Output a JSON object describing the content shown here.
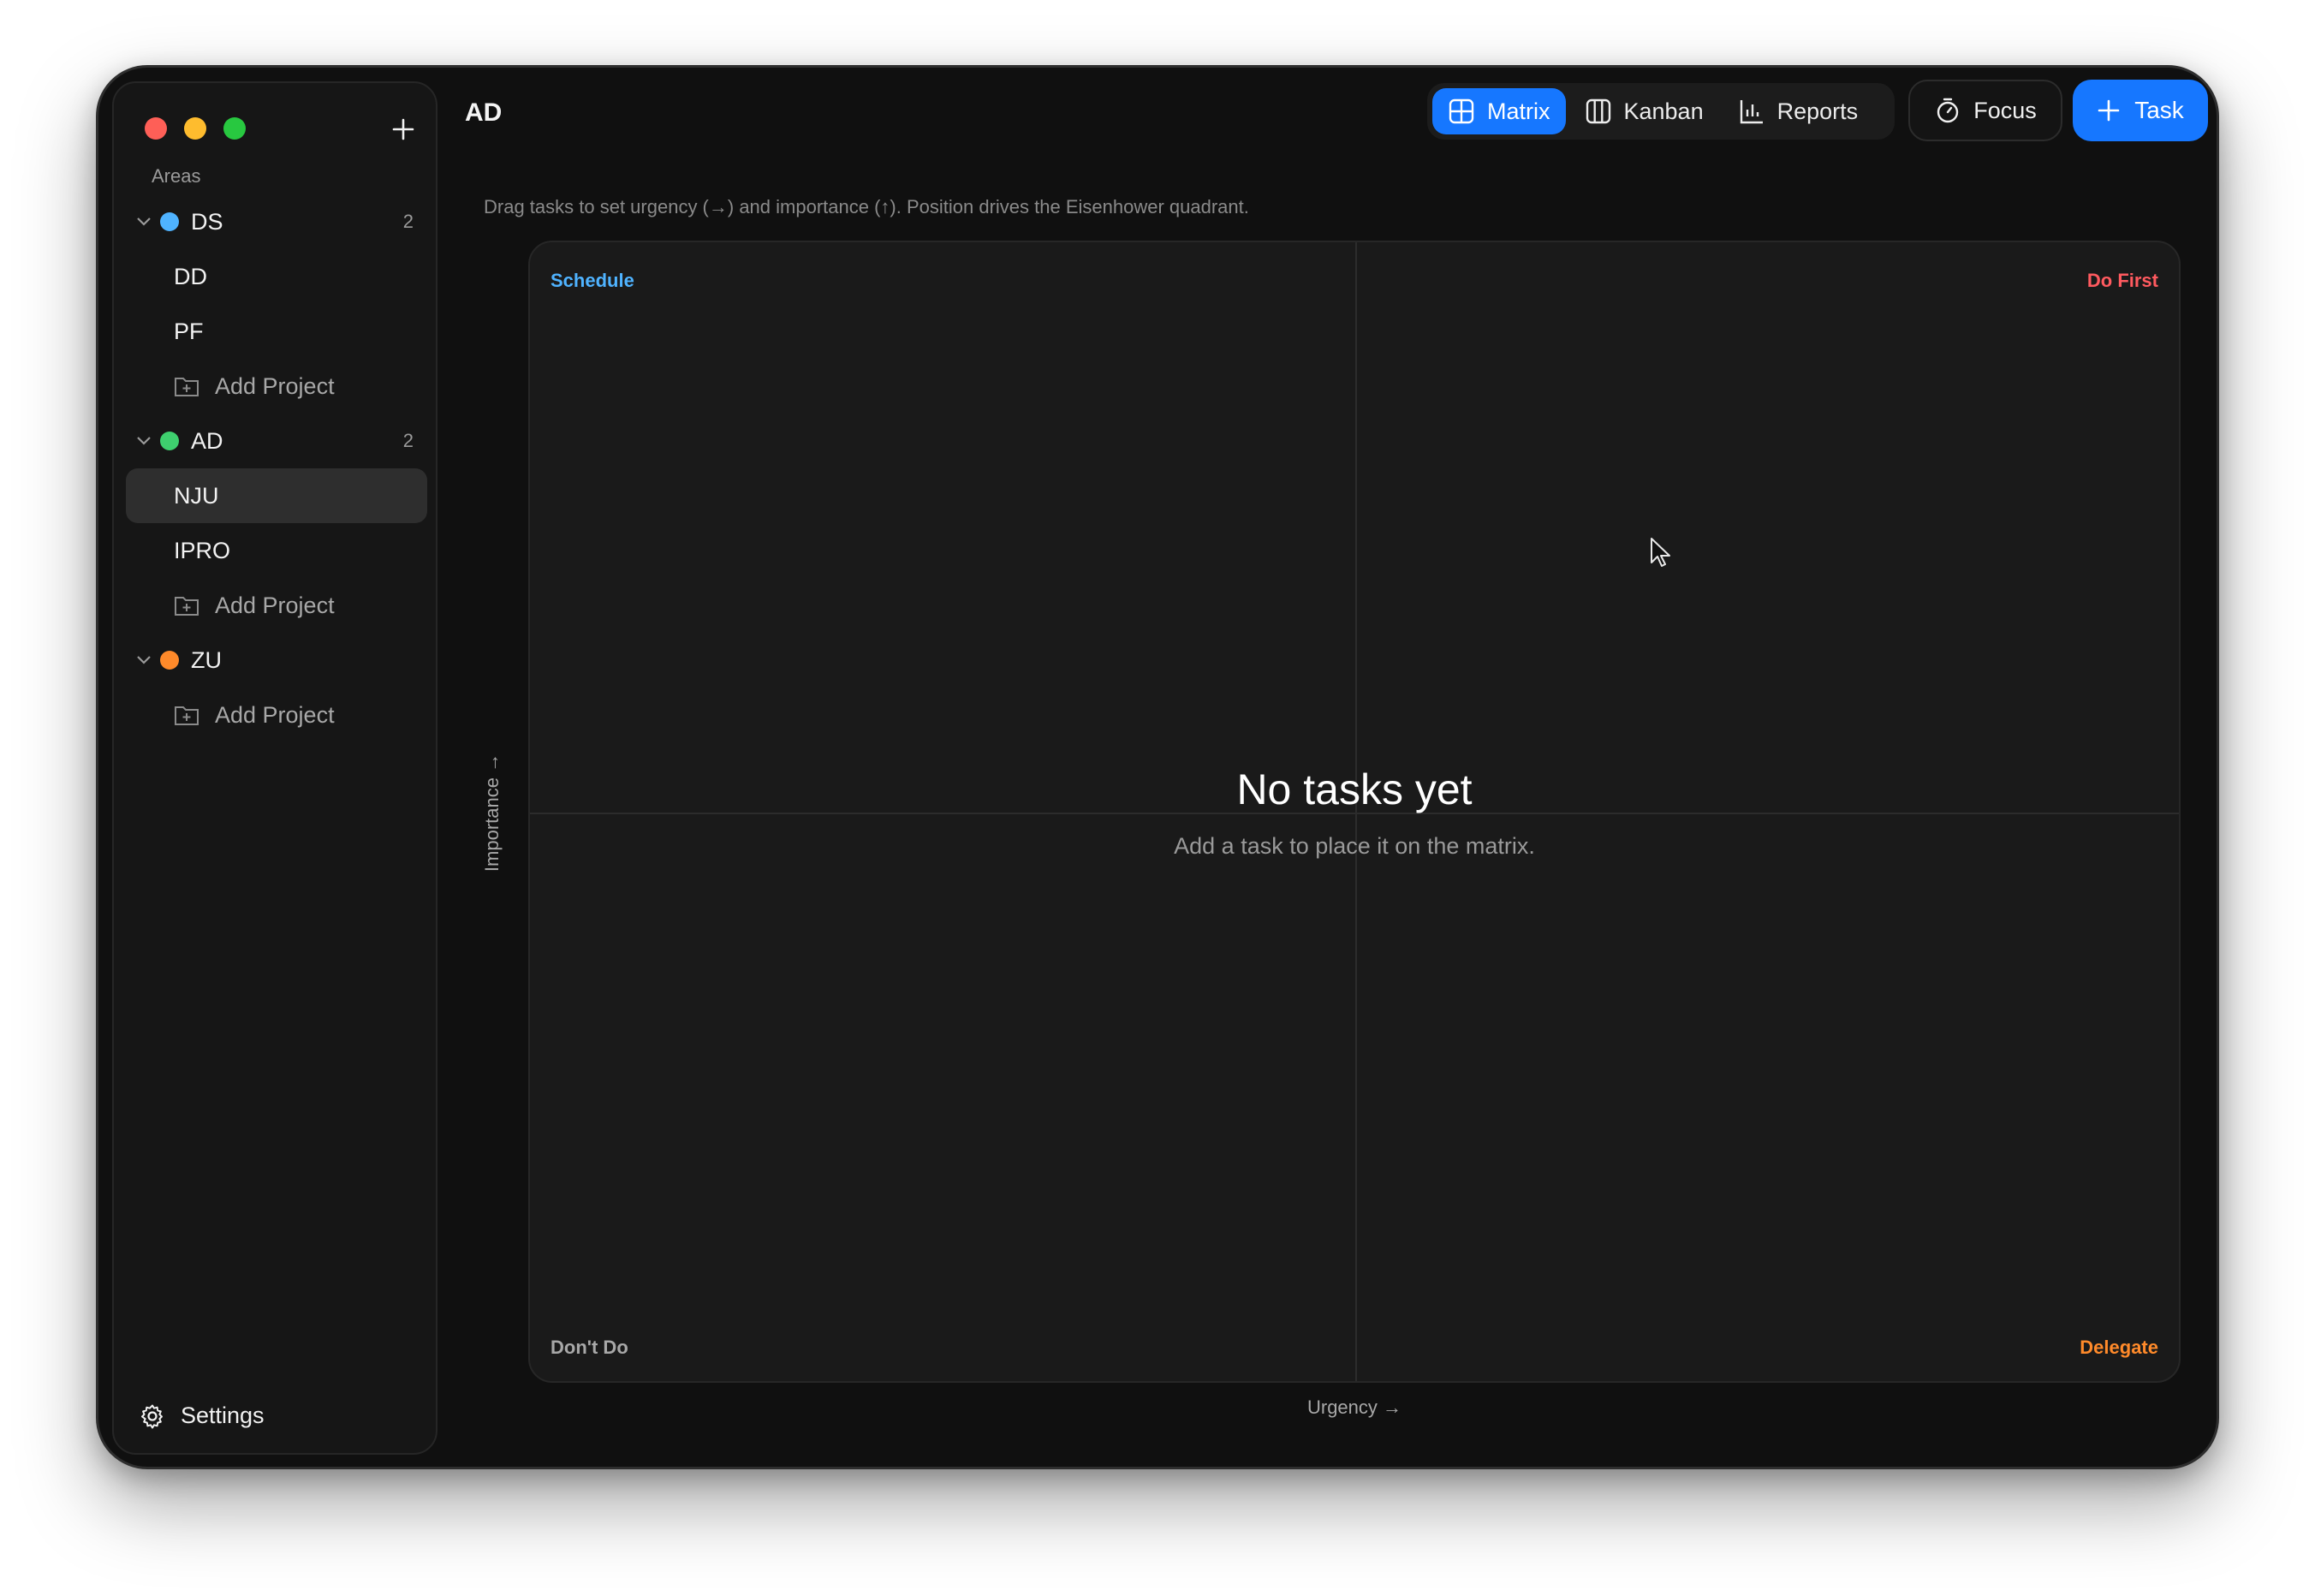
{
  "sidebar": {
    "areas_label": "Areas",
    "areas": [
      {
        "name": "DS",
        "color": "#4fb3ff",
        "count": "2",
        "projects": [
          "DD",
          "PF"
        ],
        "add_label": "Add Project"
      },
      {
        "name": "AD",
        "color": "#3ecf6e",
        "count": "2",
        "projects": [
          "NJU",
          "IPRO"
        ],
        "add_label": "Add Project"
      },
      {
        "name": "ZU",
        "color": "#ff8a2a",
        "count": "",
        "projects": [],
        "add_label": "Add Project"
      }
    ],
    "selected_project": "NJU",
    "settings_label": "Settings"
  },
  "header": {
    "title": "AD",
    "views": [
      {
        "label": "Matrix",
        "active": true
      },
      {
        "label": "Kanban",
        "active": false
      },
      {
        "label": "Reports",
        "active": false
      }
    ],
    "focus_label": "Focus",
    "task_label": "Task"
  },
  "hint": "Drag tasks to set urgency (→) and importance (↑). Position drives the Eisenhower quadrant.",
  "matrix": {
    "quadrants": {
      "top_left": "Schedule",
      "top_right": "Do First",
      "bottom_left": "Don't Do",
      "bottom_right": "Delegate"
    },
    "empty_title": "No tasks yet",
    "empty_subtitle": "Add a task to place it on the matrix.",
    "y_axis_label": "Importance →",
    "x_axis_label": "Urgency →"
  },
  "colors": {
    "accent": "#1677ff",
    "schedule": "#4fb3ff",
    "do_first": "#ff5a5f",
    "delegate": "#ff8a2a"
  }
}
